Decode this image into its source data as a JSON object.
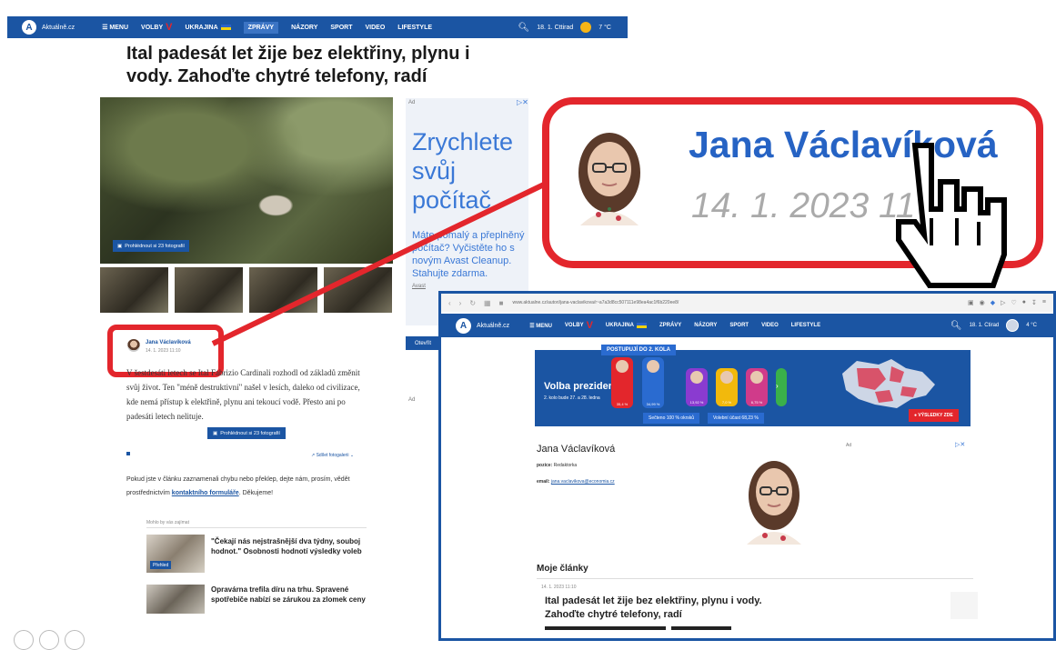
{
  "left_page": {
    "nav": {
      "logo_letter": "A",
      "logo_text": "Aktuálně.cz",
      "menu": "☰ MENU",
      "volby": "VOLBY",
      "volby_mark": "V",
      "ukrajina": "UKRAJINA",
      "zpravy": "ZPRÁVY",
      "nazory": "NÁZORY",
      "sport": "SPORT",
      "video": "VIDEO",
      "lifestyle": "LIFESTYLE",
      "date": "18. 1. Cttirad",
      "temp": "7 °C"
    },
    "headline": "Ital padesát let žije bez elektřiny, plynu i vody. Zahoďte chytré telefony, radí",
    "photo_button": "Prohlédnout si 23 fotografií",
    "ad": {
      "label": "Ad",
      "big_text": "Zrychlete svůj počítač",
      "small_text": "Máte pomalý a přeplněný počítač? Vyčistěte ho s novým Avast Cleanup. Stahujte zdarma.",
      "brand": "Avast",
      "open_button": "Otevřít",
      "ad_label_2": "Ad"
    },
    "author": {
      "name": "Jana Václavíková",
      "date": "14. 1. 2023 11:10"
    },
    "article_text": "V šestdesáti letech se Ital Fabrizio Cardinali rozhodl od základů změnit svůj život. Ten \"méně destruktivní\" našel v lesích, daleko od civilizace, kde nemá přístup k elektřině, plynu ani tekoucí vodě. Přesto ani po padesáti letech nelituje.",
    "gallery_button": "Prohlédnout si 23 fotografií",
    "share": "↗ Sdílet fotogalerii ⌄",
    "error_text_1": "Pokud jste v článku zaznamenali chybu nebo překlep, dejte nám, prosím, vědět prostřednictvím ",
    "error_link": "kontaktního formuláře",
    "error_text_2": ". Děkujeme!",
    "recommend_title": "Mohlo by vás zajímat",
    "rec1": "\"Čekají nás nejstrašnější dva týdny, souboj hodnot.\" Osobnosti hodnotí výsledky voleb",
    "rec1_tag": "Přehled",
    "rec2": "Opravárna trefila díru na trhu. Spravené spotřebiče nabízí se zárukou za zlomek ceny"
  },
  "callout": {
    "name": "Jana Václavíková",
    "date": "14. 1. 2023 11"
  },
  "right_window": {
    "url": "www.aktualne.cz/autori/jana-vaclavikova/r~a7a3d8cc507111e98ea4ac1f6b220ee8/",
    "nav": {
      "logo_letter": "A",
      "logo_text": "Aktuálně.cz",
      "menu": "☰ MENU",
      "volby": "VOLBY",
      "volby_mark": "V",
      "ukrajina": "UKRAJINA",
      "zpravy": "ZPRÁVY",
      "nazory": "NÁZORY",
      "sport": "SPORT",
      "video": "VIDEO",
      "lifestyle": "LIFESTYLE",
      "date": "18. 1. Ctirad",
      "temp": "4 °C"
    },
    "banner": {
      "tag": "POSTUPUJÍ DO 2. KOLA",
      "title": "Volba prezidenta",
      "subtitle": "2. kolo bude 27. a 28. ledna",
      "pct_1": "35,4 %",
      "pct_2": "34,99 %",
      "pct_3": "13,92 %",
      "pct_4": "7,0 %",
      "pct_5": "6,75 %",
      "pill_1": "Sečteno 100 % okrsků",
      "pill_2": "Volební účast 68,23 %",
      "results": "● VÝSLEDKY ZDE"
    },
    "profile": {
      "name": "Jana Václavíková",
      "pozice_label": "pozice:",
      "pozice": "Redaktorka",
      "email_label": "email:",
      "email": "jana.vaclavikova@economia.cz",
      "ad_label": "Ad"
    },
    "articles_title": "Moje články",
    "article_date": "14. 1. 2023 11:10",
    "article_title": "Ital padesát let žije bez elektřiny, plynu i vody. Zahoďte chytré telefony, radí"
  },
  "colors": {
    "brand_blue": "#1b55a3",
    "highlight_red": "#e3262c",
    "ad_blue": "#3a78d6"
  }
}
